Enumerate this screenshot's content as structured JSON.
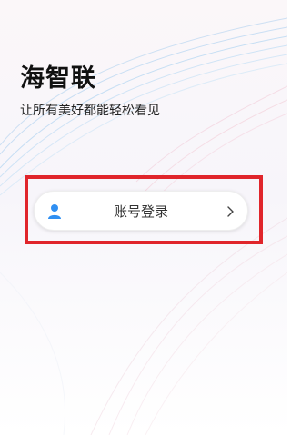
{
  "app": {
    "title": "海智联",
    "slogan": "让所有美好都能轻松看见"
  },
  "login": {
    "account_login_label": "账号登录",
    "icon": "user-icon",
    "arrow_icon": "chevron-right-icon"
  },
  "colors": {
    "accent_blue": "#2f8ff2",
    "highlight_red": "#e0252b"
  }
}
